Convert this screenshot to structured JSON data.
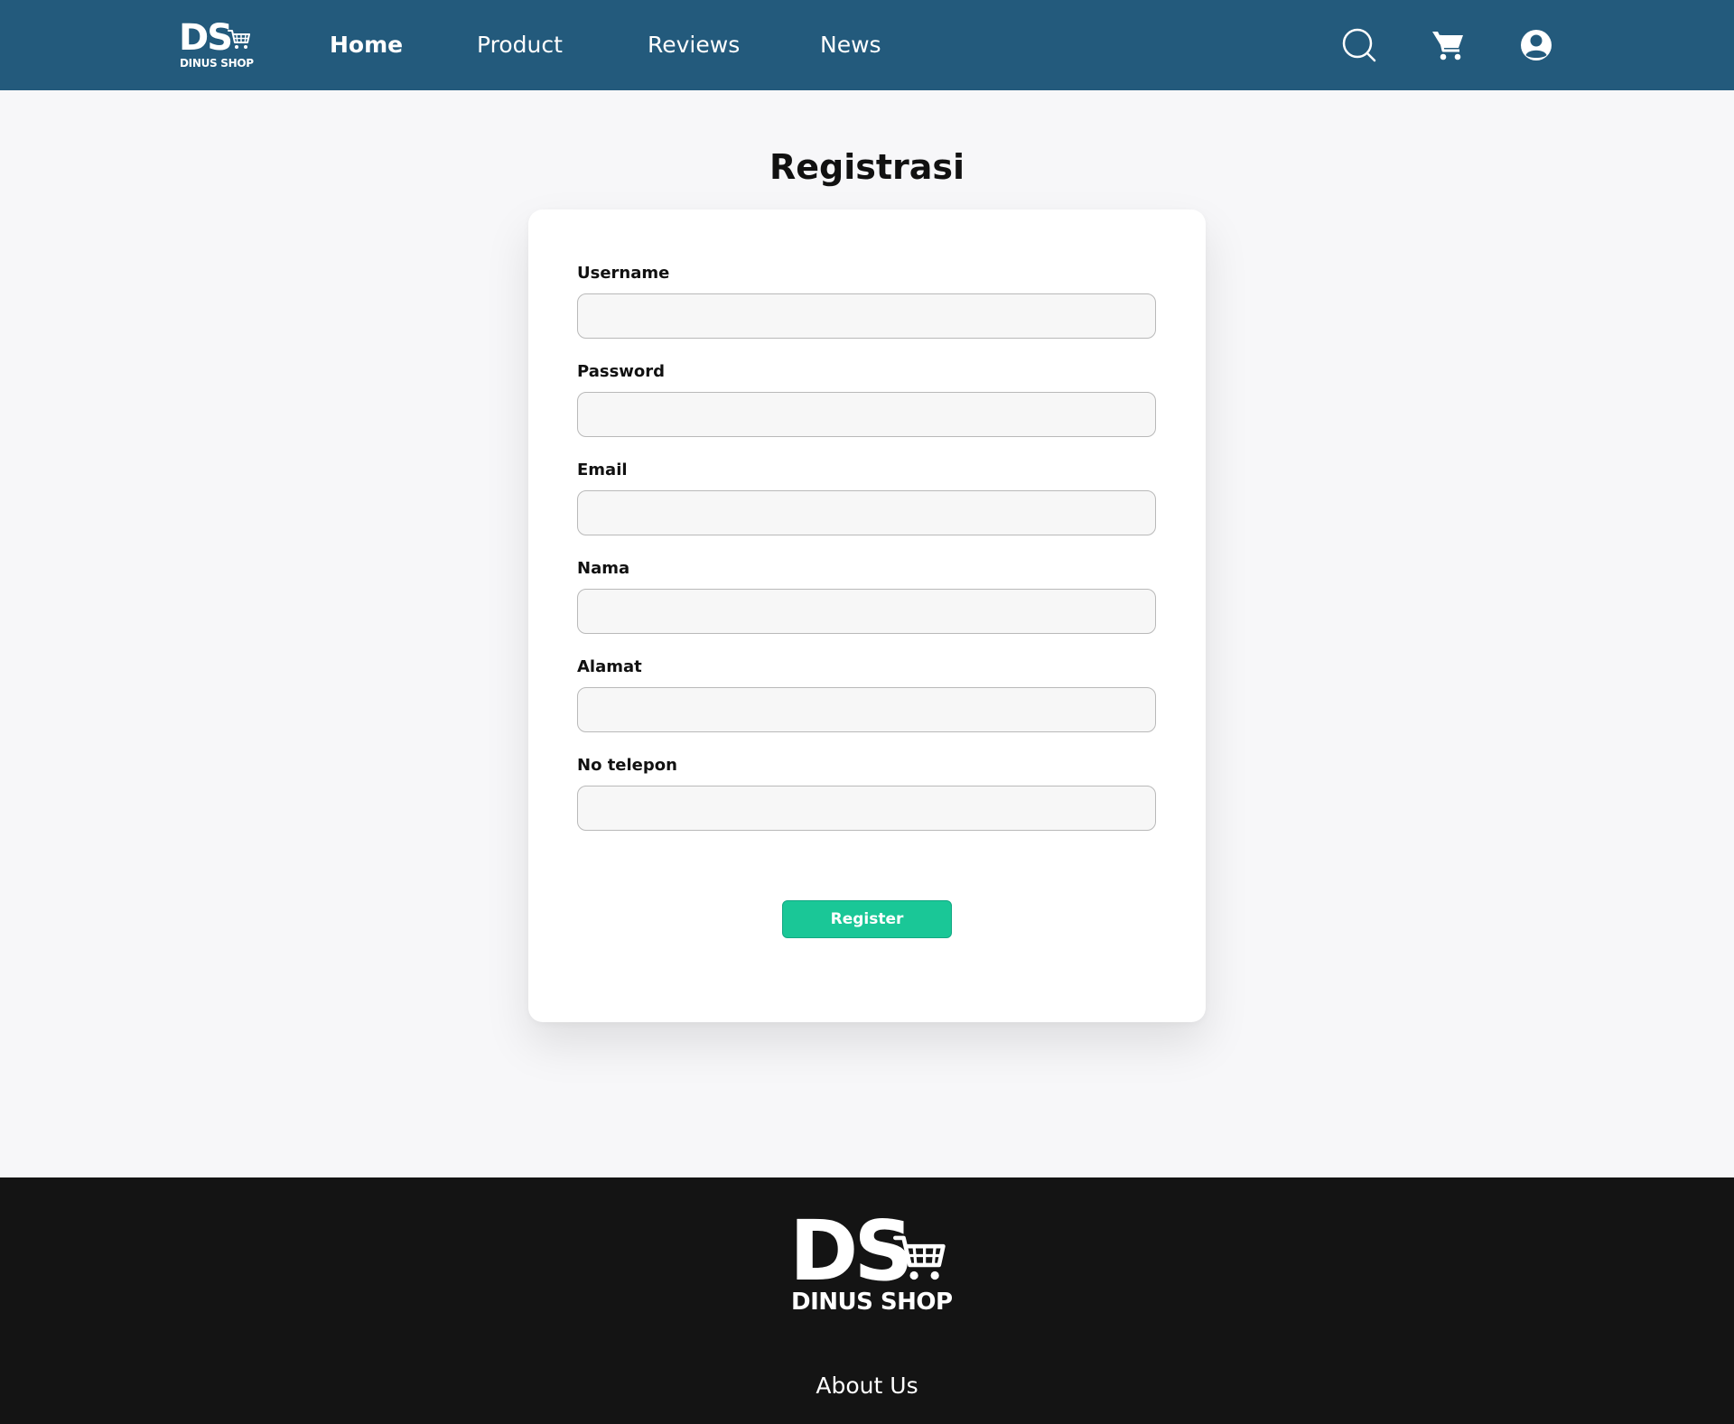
{
  "brand": {
    "logo_initials": "DS",
    "logo_name": "DINUS SHOP"
  },
  "nav": {
    "items": [
      {
        "label": "Home",
        "active": true
      },
      {
        "label": "Product",
        "active": false
      },
      {
        "label": "Reviews",
        "active": false
      },
      {
        "label": "News",
        "active": false
      }
    ],
    "icons": [
      "search-icon",
      "cart-icon",
      "user-account-icon"
    ]
  },
  "form": {
    "title": "Registrasi",
    "fields": [
      {
        "label": "Username",
        "value": "",
        "placeholder": ""
      },
      {
        "label": "Password",
        "value": "",
        "placeholder": ""
      },
      {
        "label": "Email",
        "value": "",
        "placeholder": ""
      },
      {
        "label": "Nama",
        "value": "",
        "placeholder": ""
      },
      {
        "label": "Alamat",
        "value": "",
        "placeholder": ""
      },
      {
        "label": "No telepon",
        "value": "",
        "placeholder": ""
      }
    ],
    "submit_label": "Register"
  },
  "footer": {
    "about_label": "About Us"
  },
  "colors": {
    "header_bg": "#235a7c",
    "page_bg": "#f7f7f9",
    "button_bg": "#1ac797",
    "footer_bg": "#141414"
  }
}
